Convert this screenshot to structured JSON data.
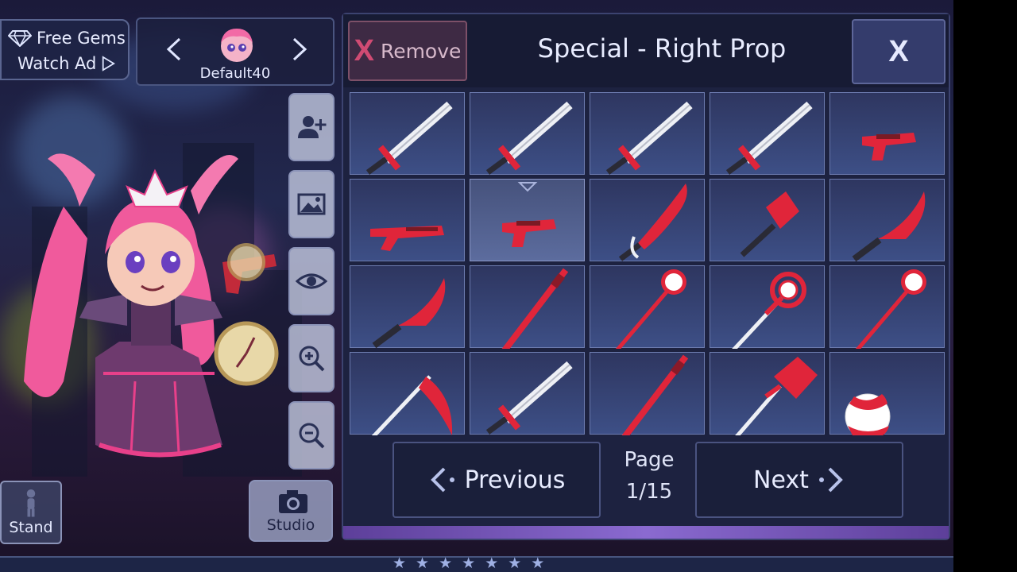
{
  "free_gems": {
    "label": "Free Gems",
    "watch_label": "Watch Ad"
  },
  "profile": {
    "name": "Default40"
  },
  "left_buttons": {
    "stand": "Stand",
    "studio": "Studio"
  },
  "tool_buttons": [
    "add-user-icon",
    "image-icon",
    "eye-icon",
    "zoom-in-icon",
    "zoom-out-icon"
  ],
  "panel": {
    "title": "Special - Right Prop",
    "remove_x": "X",
    "remove_label": "Remove",
    "close_label": "X",
    "previous_label": "Previous",
    "next_label": "Next",
    "page_label": "Page",
    "page_number": "1/15"
  },
  "items": [
    {
      "name": "sword-red-guard",
      "icon": "sword"
    },
    {
      "name": "sword-ornate-guard",
      "icon": "sword"
    },
    {
      "name": "sword-round-guard",
      "icon": "sword"
    },
    {
      "name": "sword-long-guard",
      "icon": "sword"
    },
    {
      "name": "pistol-red",
      "icon": "pistol"
    },
    {
      "name": "shotgun-red",
      "icon": "gun"
    },
    {
      "name": "pistol-red-selected",
      "icon": "pistol",
      "selected": true
    },
    {
      "name": "curved-red-blade",
      "icon": "blade"
    },
    {
      "name": "cleaver-red",
      "icon": "cleaver"
    },
    {
      "name": "knife-red",
      "icon": "knife"
    },
    {
      "name": "dagger-red",
      "icon": "knife"
    },
    {
      "name": "red-staff",
      "icon": "staff"
    },
    {
      "name": "orb-staff",
      "icon": "orb-staff"
    },
    {
      "name": "ring-staff",
      "icon": "ring-staff"
    },
    {
      "name": "crescent-staff",
      "icon": "orb-staff"
    },
    {
      "name": "scythe-red",
      "icon": "scythe"
    },
    {
      "name": "machete-silver",
      "icon": "sword"
    },
    {
      "name": "red-pipe",
      "icon": "staff"
    },
    {
      "name": "shovel-red",
      "icon": "shovel"
    },
    {
      "name": "beach-ball",
      "icon": "ball"
    }
  ],
  "colors": {
    "accent_red": "#e0253a",
    "panel_bg": "#1d2240",
    "cell_bg": "#3d4f86"
  },
  "star_rating": 7
}
